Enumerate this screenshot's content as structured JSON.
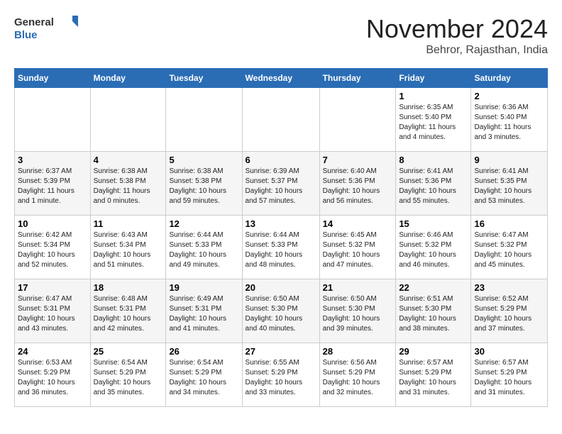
{
  "header": {
    "logo": {
      "general": "General",
      "blue": "Blue"
    },
    "month": "November 2024",
    "location": "Behror, Rajasthan, India"
  },
  "weekdays": [
    "Sunday",
    "Monday",
    "Tuesday",
    "Wednesday",
    "Thursday",
    "Friday",
    "Saturday"
  ],
  "weeks": [
    [
      {
        "day": "",
        "info": ""
      },
      {
        "day": "",
        "info": ""
      },
      {
        "day": "",
        "info": ""
      },
      {
        "day": "",
        "info": ""
      },
      {
        "day": "",
        "info": ""
      },
      {
        "day": "1",
        "info": "Sunrise: 6:35 AM\nSunset: 5:40 PM\nDaylight: 11 hours and 4 minutes."
      },
      {
        "day": "2",
        "info": "Sunrise: 6:36 AM\nSunset: 5:40 PM\nDaylight: 11 hours and 3 minutes."
      }
    ],
    [
      {
        "day": "3",
        "info": "Sunrise: 6:37 AM\nSunset: 5:39 PM\nDaylight: 11 hours and 1 minute."
      },
      {
        "day": "4",
        "info": "Sunrise: 6:38 AM\nSunset: 5:38 PM\nDaylight: 11 hours and 0 minutes."
      },
      {
        "day": "5",
        "info": "Sunrise: 6:38 AM\nSunset: 5:38 PM\nDaylight: 10 hours and 59 minutes."
      },
      {
        "day": "6",
        "info": "Sunrise: 6:39 AM\nSunset: 5:37 PM\nDaylight: 10 hours and 57 minutes."
      },
      {
        "day": "7",
        "info": "Sunrise: 6:40 AM\nSunset: 5:36 PM\nDaylight: 10 hours and 56 minutes."
      },
      {
        "day": "8",
        "info": "Sunrise: 6:41 AM\nSunset: 5:36 PM\nDaylight: 10 hours and 55 minutes."
      },
      {
        "day": "9",
        "info": "Sunrise: 6:41 AM\nSunset: 5:35 PM\nDaylight: 10 hours and 53 minutes."
      }
    ],
    [
      {
        "day": "10",
        "info": "Sunrise: 6:42 AM\nSunset: 5:34 PM\nDaylight: 10 hours and 52 minutes."
      },
      {
        "day": "11",
        "info": "Sunrise: 6:43 AM\nSunset: 5:34 PM\nDaylight: 10 hours and 51 minutes."
      },
      {
        "day": "12",
        "info": "Sunrise: 6:44 AM\nSunset: 5:33 PM\nDaylight: 10 hours and 49 minutes."
      },
      {
        "day": "13",
        "info": "Sunrise: 6:44 AM\nSunset: 5:33 PM\nDaylight: 10 hours and 48 minutes."
      },
      {
        "day": "14",
        "info": "Sunrise: 6:45 AM\nSunset: 5:32 PM\nDaylight: 10 hours and 47 minutes."
      },
      {
        "day": "15",
        "info": "Sunrise: 6:46 AM\nSunset: 5:32 PM\nDaylight: 10 hours and 46 minutes."
      },
      {
        "day": "16",
        "info": "Sunrise: 6:47 AM\nSunset: 5:32 PM\nDaylight: 10 hours and 45 minutes."
      }
    ],
    [
      {
        "day": "17",
        "info": "Sunrise: 6:47 AM\nSunset: 5:31 PM\nDaylight: 10 hours and 43 minutes."
      },
      {
        "day": "18",
        "info": "Sunrise: 6:48 AM\nSunset: 5:31 PM\nDaylight: 10 hours and 42 minutes."
      },
      {
        "day": "19",
        "info": "Sunrise: 6:49 AM\nSunset: 5:31 PM\nDaylight: 10 hours and 41 minutes."
      },
      {
        "day": "20",
        "info": "Sunrise: 6:50 AM\nSunset: 5:30 PM\nDaylight: 10 hours and 40 minutes."
      },
      {
        "day": "21",
        "info": "Sunrise: 6:50 AM\nSunset: 5:30 PM\nDaylight: 10 hours and 39 minutes."
      },
      {
        "day": "22",
        "info": "Sunrise: 6:51 AM\nSunset: 5:30 PM\nDaylight: 10 hours and 38 minutes."
      },
      {
        "day": "23",
        "info": "Sunrise: 6:52 AM\nSunset: 5:29 PM\nDaylight: 10 hours and 37 minutes."
      }
    ],
    [
      {
        "day": "24",
        "info": "Sunrise: 6:53 AM\nSunset: 5:29 PM\nDaylight: 10 hours and 36 minutes."
      },
      {
        "day": "25",
        "info": "Sunrise: 6:54 AM\nSunset: 5:29 PM\nDaylight: 10 hours and 35 minutes."
      },
      {
        "day": "26",
        "info": "Sunrise: 6:54 AM\nSunset: 5:29 PM\nDaylight: 10 hours and 34 minutes."
      },
      {
        "day": "27",
        "info": "Sunrise: 6:55 AM\nSunset: 5:29 PM\nDaylight: 10 hours and 33 minutes."
      },
      {
        "day": "28",
        "info": "Sunrise: 6:56 AM\nSunset: 5:29 PM\nDaylight: 10 hours and 32 minutes."
      },
      {
        "day": "29",
        "info": "Sunrise: 6:57 AM\nSunset: 5:29 PM\nDaylight: 10 hours and 31 minutes."
      },
      {
        "day": "30",
        "info": "Sunrise: 6:57 AM\nSunset: 5:29 PM\nDaylight: 10 hours and 31 minutes."
      }
    ]
  ]
}
